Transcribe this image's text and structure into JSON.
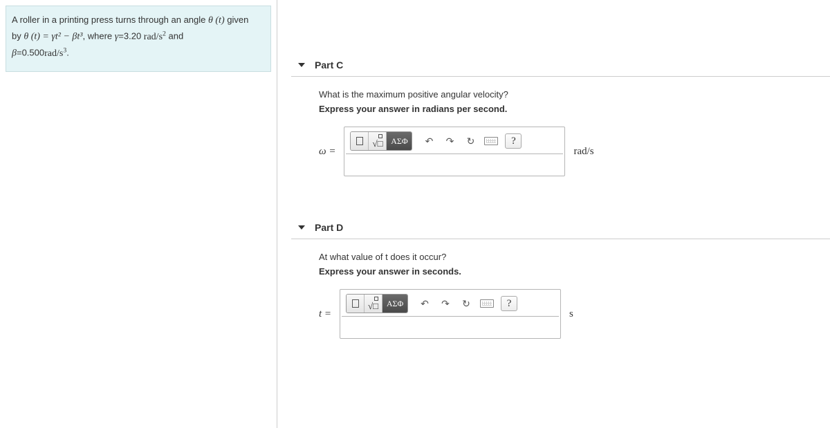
{
  "problem": {
    "line1_a": "A roller in a printing press turns through an angle ",
    "line1_theta": "θ (t)",
    "line1_b": " given",
    "line2_a": "by ",
    "line2_eq": "θ (t) = γt² − βt³",
    "line2_b": ", where ",
    "line2_gamma": "γ",
    "line2_c": "=3.20 ",
    "line2_unit": "rad/s²",
    "line2_d": " and",
    "line3_beta": "β",
    "line3_a": "=0.500",
    "line3_unit": "rad/s³",
    "line3_b": "."
  },
  "partC": {
    "title": "Part C",
    "question": "What is the maximum positive angular velocity?",
    "instruction": "Express your answer in radians per second.",
    "varLabel": "ω =",
    "unit": "rad/s",
    "greekBtn": "ΑΣΦ",
    "help": "?"
  },
  "partD": {
    "title": "Part D",
    "question_a": "At what value of ",
    "question_t": "t",
    "question_b": " does it occur?",
    "instruction": "Express your answer in seconds.",
    "varLabel": "t =",
    "unit": "s",
    "greekBtn": "ΑΣΦ",
    "help": "?"
  }
}
